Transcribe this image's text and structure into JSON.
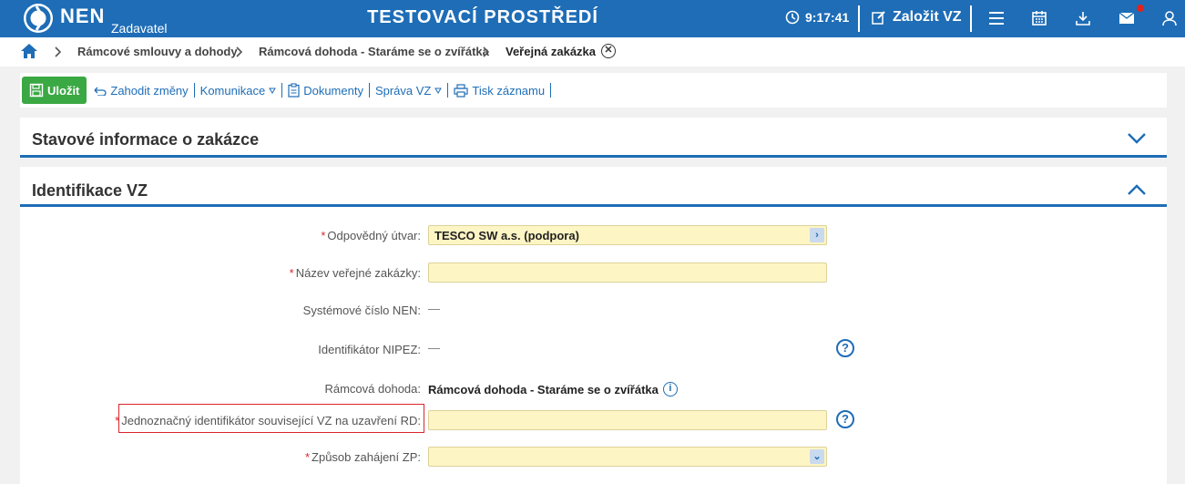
{
  "header": {
    "brand": "NEN",
    "brand_sub": "Zadavatel",
    "environment": "TESTOVACÍ PROSTŘEDÍ",
    "time": "9:17:41",
    "create_label": "Založit VZ",
    "icons": [
      "menu-icon",
      "calendar-icon",
      "download-icon",
      "mail-icon",
      "user-icon"
    ]
  },
  "breadcrumb": {
    "items": [
      "Rámcové smlouvy a dohody",
      "Rámcová dohoda - Staráme se o zvířátka",
      "Veřejná zakázka"
    ],
    "close_symbol": "✕"
  },
  "toolbar": {
    "save_label": "Uložit",
    "discard_label": "Zahodit změny",
    "communication_label": "Komunikace",
    "documents_label": "Dokumenty",
    "manage_label": "Správa VZ",
    "print_label": "Tisk záznamu"
  },
  "panels": {
    "status_title": "Stavové informace o zakázce",
    "identification_title": "Identifikace VZ"
  },
  "form": {
    "responsible_unit_label": "Odpovědný útvar:",
    "responsible_unit_value": "TESCO SW a.s. (podpora)",
    "contract_name_label": "Název veřejné zakázky:",
    "contract_name_value": "",
    "system_number_label": "Systémové číslo NEN:",
    "system_number_value": "—",
    "nipez_label": "Identifikátor NIPEZ:",
    "nipez_value": "—",
    "framework_label": "Rámcová dohoda:",
    "framework_value": "Rámcová dohoda - Staráme se o zvířátka",
    "unique_id_label": "Jednoznačný identifikátor související VZ na uzavření RD:",
    "unique_id_value": "",
    "procedure_start_label": "Způsob zahájení ZP:",
    "procedure_start_value": "",
    "required_mark": "*",
    "help_symbol": "?",
    "info_symbol": "i"
  },
  "colors": {
    "brand_blue": "#1e6db6",
    "save_green": "#3aa843",
    "input_yellow": "#fdf5c4",
    "required_red": "#d9262c"
  }
}
